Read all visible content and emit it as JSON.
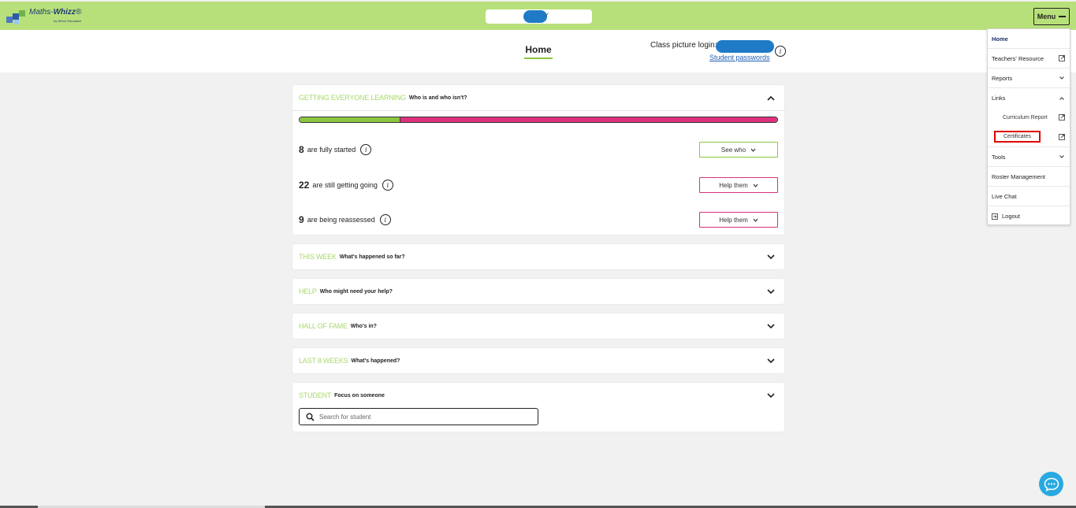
{
  "app": {
    "logo_name": "Maths-",
    "logo_bold": "Whizz",
    "logo_tag": "®",
    "logo_sub": "by Whizz Education"
  },
  "header": {
    "menu_label": "Menu",
    "home_tab": "Home",
    "class_picture_login": "Class picture login:",
    "student_passwords": "Student passwords"
  },
  "cards": {
    "getting": {
      "title": "GETTING EVERYONE LEARNING",
      "subtitle": "Who is and who isn't?",
      "progress": {
        "green_fraction": 0.212,
        "green": "#8cc63f",
        "pink": "#e0317d"
      },
      "rows": [
        {
          "count": "8",
          "label": "are fully started",
          "button": "See who",
          "style": "green"
        },
        {
          "count": "22",
          "label": "are still getting going",
          "button": "Help them",
          "style": "pink"
        },
        {
          "count": "9",
          "label": "are being reassessed",
          "button": "Help them",
          "style": "pink"
        }
      ]
    },
    "this_week": {
      "title": "THIS WEEK",
      "subtitle": "What's happened so far?"
    },
    "help": {
      "title": "HELP",
      "subtitle": "Who might need your help?"
    },
    "hall_of_fame": {
      "title": "HALL OF FAME",
      "subtitle": "Who's in?"
    },
    "last_8_weeks": {
      "title": "LAST 8 WEEKS",
      "subtitle": "What's happened?"
    },
    "student": {
      "title": "STUDENT",
      "subtitle": "Focus on someone",
      "search_placeholder": "Search for student"
    }
  },
  "menu": {
    "items": {
      "home": "Home",
      "teachers_resource": "Teachers' Resource",
      "reports": "Reports",
      "links": "Links",
      "curriculum_report": "Curriculum Report",
      "certificates": "Certificates",
      "tools": "Tools",
      "roster_management": "Roster Management",
      "live_chat": "Live Chat",
      "logout": "Logout"
    }
  },
  "colors": {
    "brand_green": "#b8e07a",
    "accent_green": "#8cc63f",
    "pink": "#e0317d",
    "link_blue": "#1f5fb5",
    "chat_blue": "#29a9e1",
    "highlight_red": "#e00000"
  },
  "icons": {
    "chevron": "chevron-icon",
    "info": "info-icon",
    "external": "external-link-icon",
    "search": "search-icon",
    "chat": "chat-icon",
    "logout": "logout-icon"
  }
}
